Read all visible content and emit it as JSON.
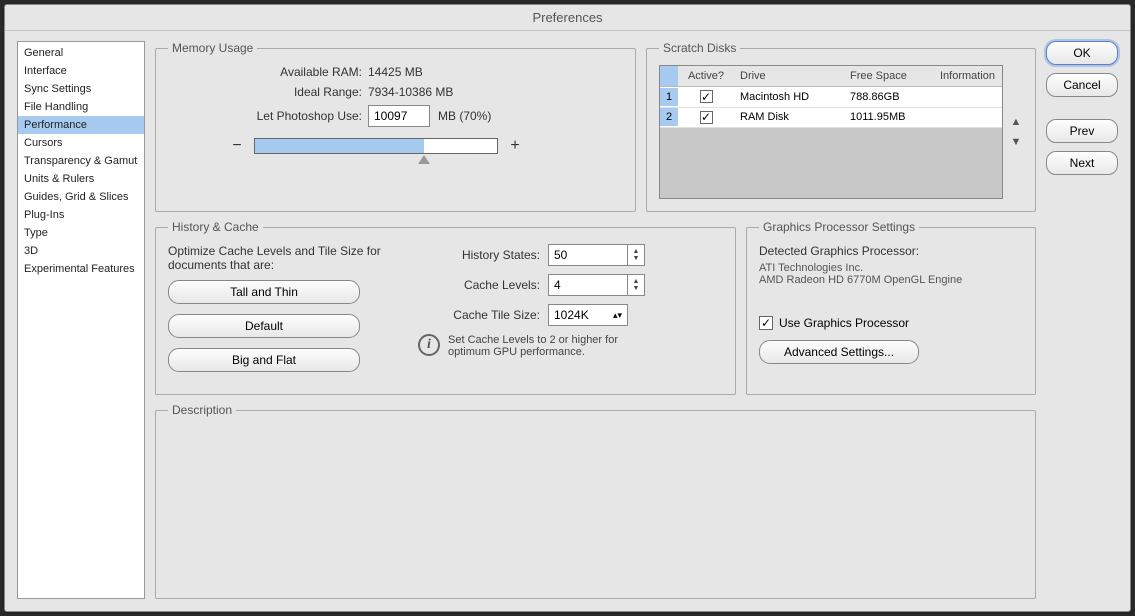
{
  "window": {
    "title": "Preferences"
  },
  "sidebar": {
    "items": [
      "General",
      "Interface",
      "Sync Settings",
      "File Handling",
      "Performance",
      "Cursors",
      "Transparency & Gamut",
      "Units & Rulers",
      "Guides, Grid & Slices",
      "Plug-Ins",
      "Type",
      "3D",
      "Experimental Features"
    ],
    "selected": "Performance"
  },
  "memory": {
    "legend": "Memory Usage",
    "available_label": "Available RAM:",
    "available_value": "14425 MB",
    "ideal_label": "Ideal Range:",
    "ideal_value": "7934-10386 MB",
    "use_label": "Let Photoshop Use:",
    "use_value": "10097",
    "use_suffix": "MB (70%)",
    "minus": "−",
    "plus": "+"
  },
  "scratch": {
    "legend": "Scratch Disks",
    "headers": {
      "active": "Active?",
      "drive": "Drive",
      "free": "Free Space",
      "info": "Information"
    },
    "rows": [
      {
        "n": "1",
        "active": true,
        "drive": "Macintosh HD",
        "free": "788.86GB",
        "info": ""
      },
      {
        "n": "2",
        "active": true,
        "drive": "RAM Disk",
        "free": "1011.95MB",
        "info": ""
      }
    ]
  },
  "history": {
    "legend": "History & Cache",
    "optimize_text": "Optimize Cache Levels and Tile Size for documents that are:",
    "buttons": {
      "tall": "Tall and Thin",
      "default": "Default",
      "big": "Big and Flat"
    },
    "history_states_label": "History States:",
    "history_states_value": "50",
    "cache_levels_label": "Cache Levels:",
    "cache_levels_value": "4",
    "cache_tile_label": "Cache Tile Size:",
    "cache_tile_value": "1024K",
    "hint": "Set Cache Levels to 2 or higher for optimum GPU performance."
  },
  "gpu": {
    "legend": "Graphics Processor Settings",
    "detected_label": "Detected Graphics Processor:",
    "vendor": "ATI Technologies Inc.",
    "model": "AMD Radeon HD 6770M OpenGL Engine",
    "use_label": "Use Graphics Processor",
    "advanced": "Advanced Settings..."
  },
  "description": {
    "legend": "Description"
  },
  "buttons": {
    "ok": "OK",
    "cancel": "Cancel",
    "prev": "Prev",
    "next": "Next"
  }
}
